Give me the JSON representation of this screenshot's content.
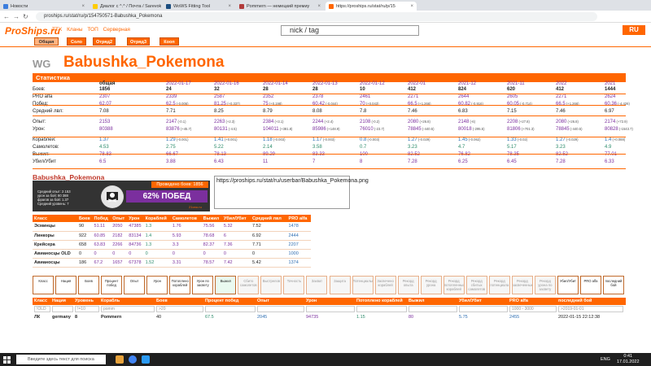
{
  "browser": {
    "tabs": [
      {
        "label": "Новости",
        "color": "#3b7ddd"
      },
      {
        "label": "Диалог с ^.^ / Почта / Sarevok",
        "color": "#ffcc00"
      },
      {
        "label": "WoWS Fitting Tool",
        "color": "#1a4d80"
      },
      {
        "label": "Pommern — немецкий премиу",
        "color": "#b23b3b"
      },
      {
        "label": "https://proships.ru/stat/ru/p/15",
        "color": "#ff6600"
      }
    ],
    "url": "proships.ru/stat/ru/p/154750571-Babushka_Pokemona"
  },
  "site": {
    "logo": "ProShips.ru",
    "nav": [
      "ТТХ",
      "Кланы",
      "ТОП",
      "Серверная"
    ],
    "search_placeholder": "nick / tag",
    "lang_button": "RU",
    "modes": [
      "Общая",
      "Соло",
      "Отряд2",
      "Отряд3",
      "Кооп"
    ]
  },
  "player": {
    "clan": "WG",
    "name": "Babushka_Pokemona"
  },
  "stats": {
    "title": "Статистика",
    "columns": [
      "общая",
      "2022-01-17",
      "2022-01-16",
      "2022-01-14",
      "2022-01-13",
      "2022-01-12",
      "2022-01",
      "2021-12",
      "2021-11",
      "2022",
      "2021"
    ],
    "rows": [
      {
        "label": "Боев:",
        "cls": "c-dark",
        "bold": true,
        "values": [
          "1856",
          "24",
          "32",
          "28",
          "28",
          "10",
          "412",
          "824",
          "620",
          "412",
          "1444"
        ],
        "deltas": []
      },
      {
        "label": "PRO alfa",
        "cls": "c-purple",
        "values": [
          "2307",
          "2339",
          "2587",
          "2352",
          "2378",
          "2461",
          "2271",
          "2644",
          "2605",
          "2271",
          "2624"
        ],
        "deltas": []
      },
      {
        "label": "Побед:",
        "cls": "c-purple",
        "values": [
          "62.07",
          "62.5",
          "81.25",
          "75",
          "60.42",
          "70",
          "66.5",
          "60.82",
          "60.05",
          "66.5",
          "60.36"
        ],
        "deltas": [
          "",
          "(-0.006)",
          "(+0.337)",
          "(+0.198)",
          "(-0.044)",
          "(+0.043)",
          "(+1.266)",
          "(-0.916)",
          "(-0.714)",
          "(+1.266)",
          "(-4.426)"
        ]
      },
      {
        "label": "Средний лвл:",
        "cls": "c-dark",
        "values": [
          "7.08",
          "7.71",
          "8.25",
          "8.79",
          "8.08",
          "7.8",
          "7.46",
          "6.83",
          "7.15",
          "7.46",
          "6.97"
        ],
        "deltas": []
      },
      {
        "label": "Опыт:",
        "cls": "c-purple",
        "values": [
          "2153",
          "2147",
          "2263",
          "2384",
          "2244",
          "2108",
          "2080",
          "2148",
          "2208",
          "2080",
          "2174"
        ],
        "deltas": [
          "",
          "(-0.1)",
          "(+2.3)",
          "(+3.1)",
          "(+2.4)",
          "(-0.2)",
          "(+26.8)",
          "(-6)",
          "(+27.8)",
          "(+26.8)",
          "(+72.9)"
        ]
      },
      {
        "label": "Урон:",
        "cls": "c-purple",
        "values": [
          "80388",
          "83876",
          "80131",
          "104011",
          "85986",
          "76010",
          "78845",
          "80018",
          "81806",
          "78845",
          "80828"
        ],
        "deltas": [
          "",
          "(+45.7)",
          "(-4.5)",
          "(+381.8)",
          "(+148.9)",
          "(-23.7)",
          "(-440.5)",
          "(-295.5)",
          "(+701.3)",
          "(-440.5)",
          "(-1543.7)"
        ]
      },
      {
        "label": "Кораблей:",
        "cls": "c-blue",
        "values": [
          "1.37",
          "1.29",
          "1.41",
          "1.18",
          "1.17",
          "0.8",
          "1.27",
          "1.45",
          "1.33",
          "1.27",
          "1.4"
        ],
        "deltas": [
          "",
          "(-0.001)",
          "(+0.001)",
          "(-0.003)",
          "(-0.003)",
          "(-0.003)",
          "(-0.029)",
          "(-0.062)",
          "(-0.02)",
          "(-0.029)",
          "(+0.088)"
        ]
      },
      {
        "label": "Самолетов:",
        "cls": "c-green",
        "values": [
          "4.53",
          "2.75",
          "5.22",
          "2.14",
          "3.58",
          "0.7",
          "3.23",
          "4.7",
          "5.17",
          "3.23",
          "4.9"
        ],
        "deltas": []
      },
      {
        "label": "Выжил:",
        "cls": "c-purple",
        "values": [
          "78.83",
          "66.67",
          "78.13",
          "89.29",
          "83.33",
          "100",
          "82.52",
          "76.82",
          "78.35",
          "82.52",
          "77.01"
        ],
        "deltas": []
      },
      {
        "label": "Убил/Убит",
        "cls": "c-purple",
        "values": [
          "6.5",
          "3.88",
          "6.43",
          "11",
          "7",
          "8",
          "7.28",
          "6.25",
          "6.45",
          "7.28",
          "6.33"
        ],
        "deltas": []
      }
    ]
  },
  "card": {
    "title": "Babushka_Pokemona",
    "battles_label": "Проведено боев: 1856",
    "win_label": "62% ПОБЕД",
    "lines": [
      "Средний опыт:  2 153",
      "урон за бой:  80 388",
      "фрагов за бой:  1.37",
      "Средний уровень:  7"
    ],
    "site": "21ono.ru"
  },
  "userbar_text": "https://proships.ru/stat/ru/userbar/Babushka_Pokemona.png",
  "classes": {
    "headers": [
      "Класс",
      "Боев",
      "Побед",
      "Опыт",
      "Урон",
      "Кораблей",
      "Самолетов",
      "Выжил",
      "Убил/Убит",
      "Средний лвл",
      "PRO alfa"
    ],
    "rows": [
      [
        "Эсминцы",
        "90",
        "51.11",
        "2050",
        "47385",
        "1.3",
        "1.76",
        "75.56",
        "5.32",
        "7.52",
        "1478"
      ],
      [
        "Линкоры",
        "922",
        "60.85",
        "2182",
        "83134",
        "1.4",
        "5.93",
        "78.68",
        "6",
        "6.92",
        "2444"
      ],
      [
        "Крейсера",
        "658",
        "63.83",
        "2266",
        "84736",
        "1.3",
        "3.3",
        "82.37",
        "7.36",
        "7.71",
        "2207"
      ],
      [
        "Авианосцы OLD",
        "0",
        "0",
        "0",
        "0",
        "0",
        "0",
        "0",
        "0",
        "0",
        "1000"
      ],
      [
        "Авианосцы",
        "186",
        "67.2",
        "1657",
        "67378",
        "1.52",
        "3.31",
        "78.57",
        "7.42",
        "5.42",
        "1374"
      ]
    ]
  },
  "filters": [
    "Класс",
    "Нация",
    "Боев",
    "Процент побед",
    "Опыт",
    "Урон",
    "Потоплено кораблей",
    "Урон по засвету",
    "Выжил",
    "Сбито самолетов",
    "Выстрелов",
    "Точность",
    "Захват",
    "Защита",
    "Потенциальн",
    "Засвечено кораблей",
    "Рекорд опыта",
    "Рекорд урона",
    "Рекорд потопленных кораблей",
    "Рекорд сбитых самолетов",
    "Рекорд потенциала",
    "Рекорд засвеченных",
    "Рекорд урона по засвету",
    "Убил/Убит",
    "PRO alfa",
    "последний бой"
  ],
  "results": {
    "headers": [
      "Класс",
      "Нация",
      "Уровень",
      "Корабль",
      "Боев",
      "Процент побед",
      "Опыт",
      "Урон",
      "Потоплено кораблей",
      "Выжил",
      "Убил/Убит",
      "PRO alfa",
      "последний бой"
    ],
    "filter_values": [
      "!OLD",
      "",
      "!=10",
      "pomm",
      ">20",
      "",
      "",
      "",
      "",
      "",
      "",
      "1000 - 3000",
      ">2019-01-01"
    ],
    "row": [
      "ЛК",
      "germany",
      "8",
      "Pommern",
      "40",
      "67.5",
      "2045",
      "94735",
      "1.15",
      "80",
      "5.75",
      "2455",
      "2022-01-15 22:12:38"
    ]
  },
  "taskbar": {
    "search": "Введите здесь текст для поиска",
    "lang": "ENG",
    "time": "0:41",
    "date": "17.01.2022"
  }
}
